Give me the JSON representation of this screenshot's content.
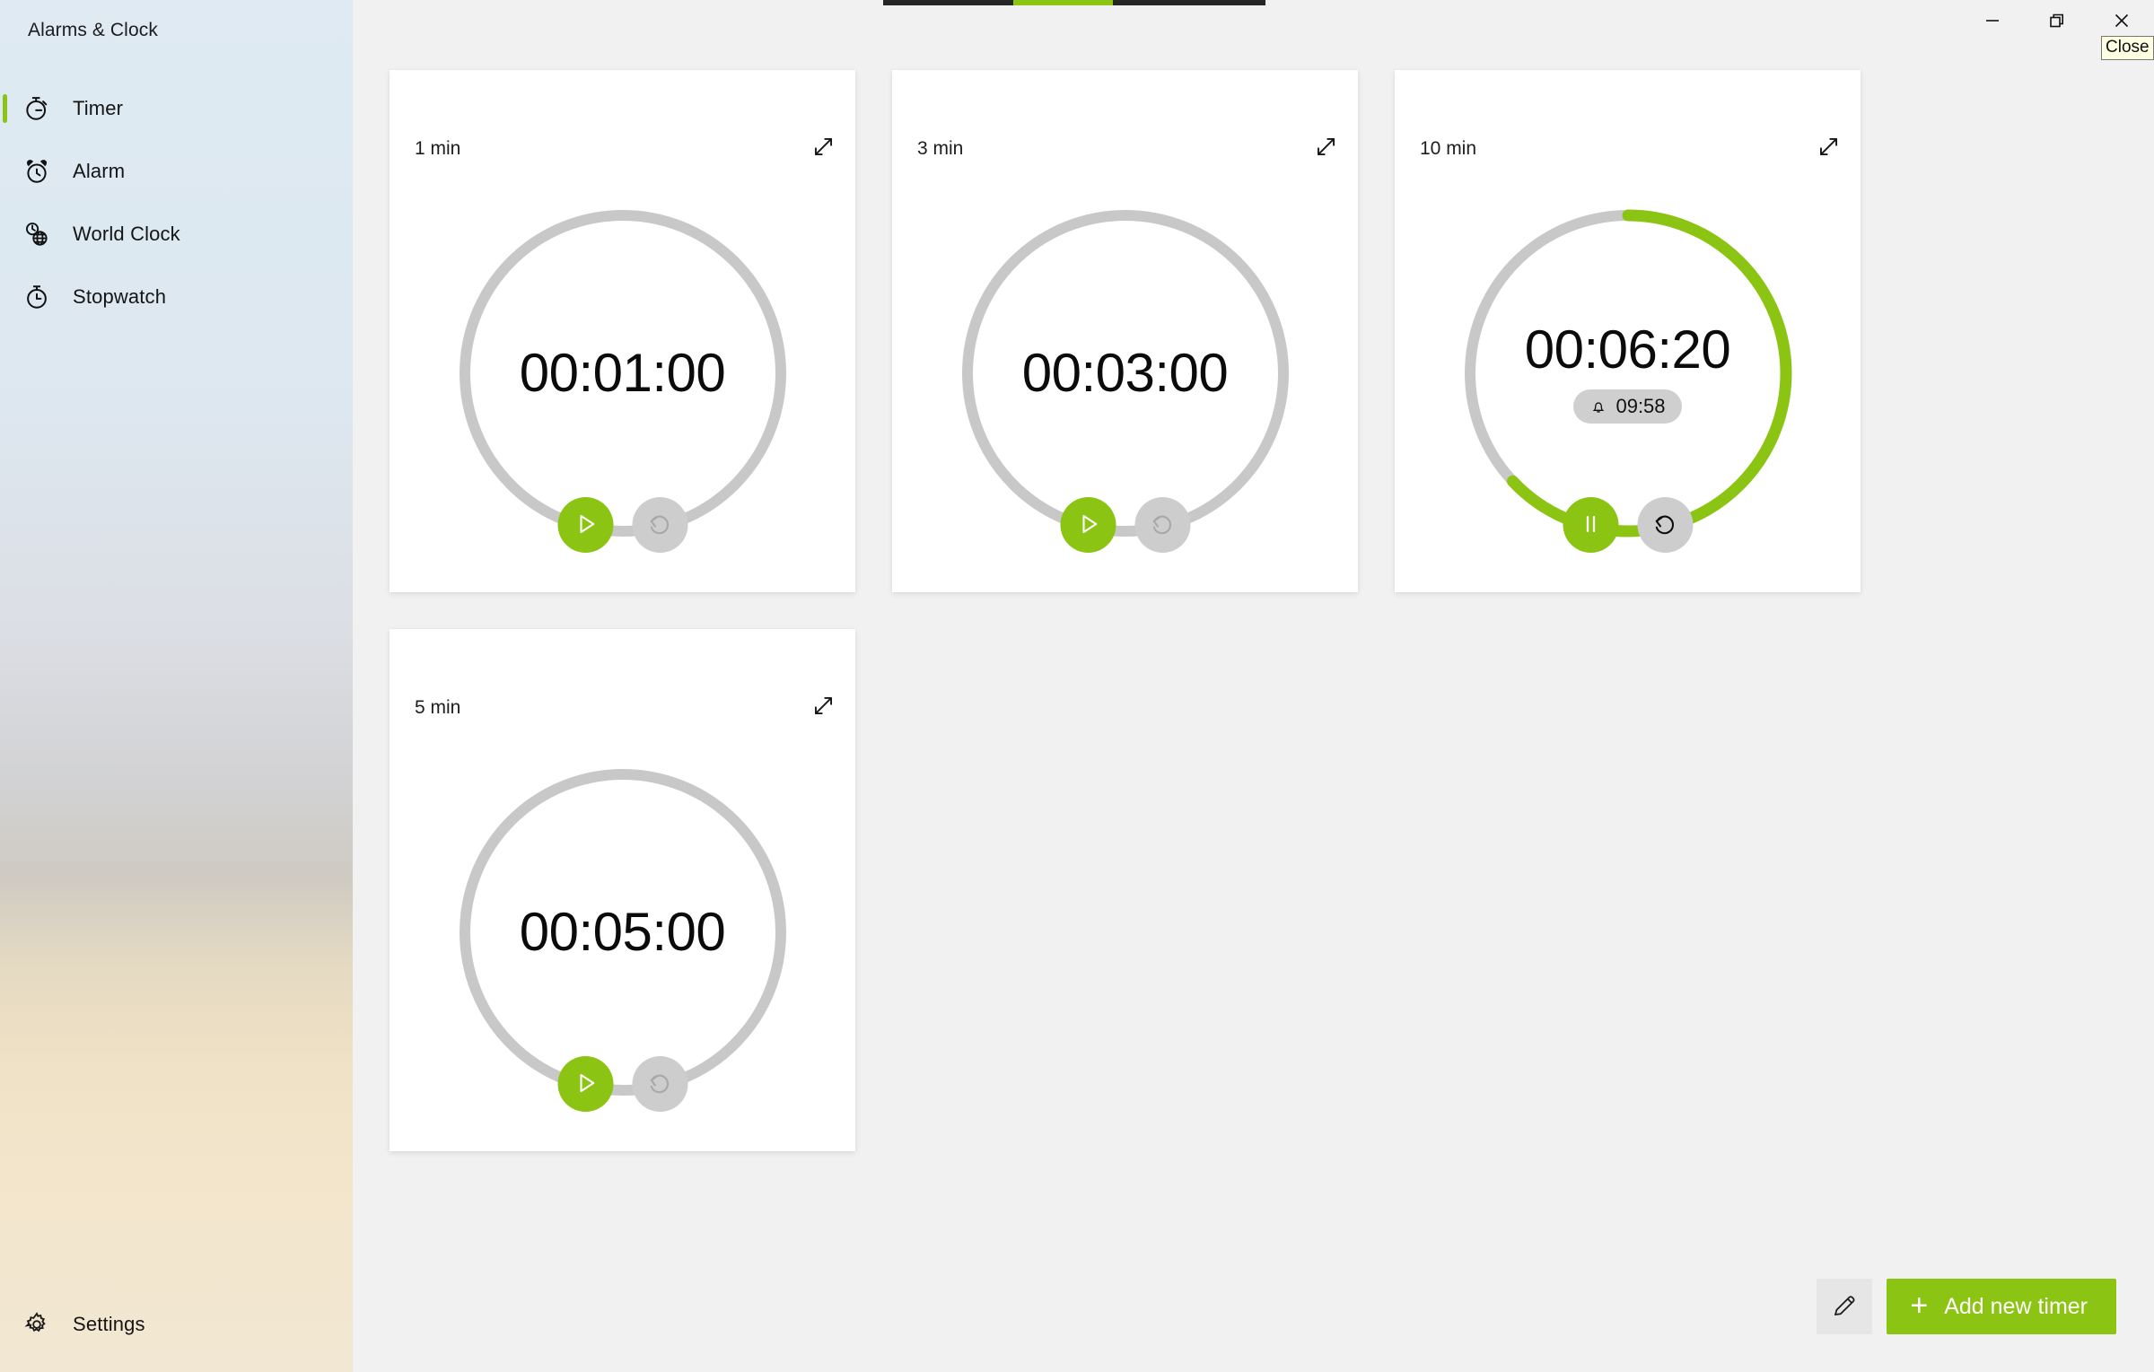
{
  "window": {
    "app_title": "Alarms & Clock",
    "minimize_label": "Minimize",
    "restore_label": "Restore",
    "close_label": "Close",
    "close_tooltip": "Close"
  },
  "accent": {
    "green": "#8cc413",
    "ring_track": "#c8c8c8",
    "card_bg": "#ffffff",
    "main_bg": "#f1f1f1"
  },
  "top_progress": {
    "segments": [
      {
        "kind": "dark",
        "width_pct": 34
      },
      {
        "kind": "green",
        "width_pct": 26
      },
      {
        "kind": "dark",
        "width_pct": 40
      }
    ]
  },
  "sidebar": {
    "items": [
      {
        "label": "Timer",
        "icon": "timer-icon",
        "selected": true
      },
      {
        "label": "Alarm",
        "icon": "alarm-clock-icon",
        "selected": false
      },
      {
        "label": "World Clock",
        "icon": "world-clock-icon",
        "selected": false
      },
      {
        "label": "Stopwatch",
        "icon": "stopwatch-icon",
        "selected": false
      }
    ],
    "settings": {
      "label": "Settings",
      "icon": "gear-icon"
    }
  },
  "main": {
    "timers": [
      {
        "label": "1 min",
        "time": "00:01:00",
        "total_seconds": 60,
        "remaining_seconds": 60,
        "progress_pct": 0,
        "state": "stopped",
        "primary_icon": "play-icon",
        "primary_label": "Start",
        "reset_icon": "reset-icon",
        "reset_label": "Reset",
        "reset_enabled": false,
        "expand_icon": "expand-icon",
        "expand_label": "Expand",
        "alarm_badge": null
      },
      {
        "label": "3 min",
        "time": "00:03:00",
        "total_seconds": 180,
        "remaining_seconds": 180,
        "progress_pct": 0,
        "state": "stopped",
        "primary_icon": "play-icon",
        "primary_label": "Start",
        "reset_icon": "reset-icon",
        "reset_label": "Reset",
        "reset_enabled": false,
        "expand_icon": "expand-icon",
        "expand_label": "Expand",
        "alarm_badge": null
      },
      {
        "label": "10 min",
        "time": "00:06:20",
        "total_seconds": 600,
        "remaining_seconds": 380,
        "progress_pct": 63,
        "state": "running",
        "primary_icon": "pause-icon",
        "primary_label": "Pause",
        "reset_icon": "reset-icon",
        "reset_label": "Reset",
        "reset_enabled": true,
        "expand_icon": "expand-icon",
        "expand_label": "Expand",
        "alarm_badge": {
          "icon": "bell-icon",
          "text": "09:58"
        }
      },
      {
        "label": "5 min",
        "time": "00:05:00",
        "total_seconds": 300,
        "remaining_seconds": 300,
        "progress_pct": 0,
        "state": "stopped",
        "primary_icon": "play-icon",
        "primary_label": "Start",
        "reset_icon": "reset-icon",
        "reset_label": "Reset",
        "reset_enabled": false,
        "expand_icon": "expand-icon",
        "expand_label": "Expand",
        "alarm_badge": null
      }
    ],
    "bottom_actions": {
      "edit_icon": "pencil-icon",
      "edit_label": "Edit timers",
      "add_icon": "plus-icon",
      "add_label": "Add new timer"
    }
  }
}
